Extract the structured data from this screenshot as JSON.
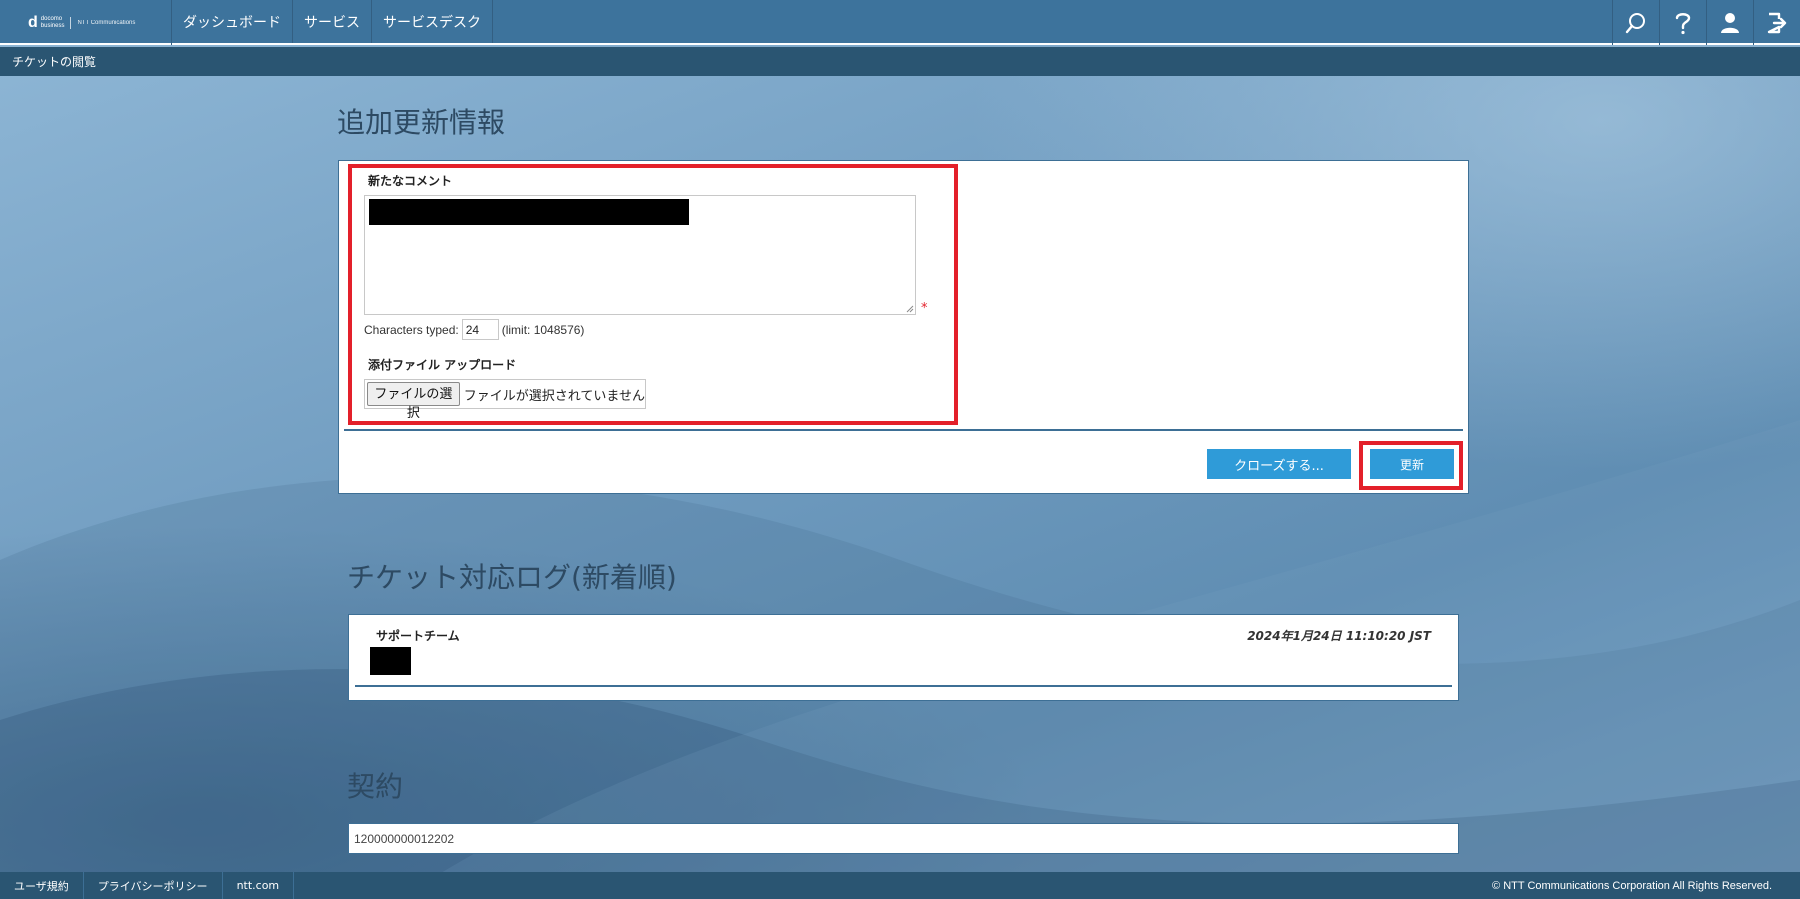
{
  "header": {
    "logo": {
      "mark": "d",
      "line1": "docomo",
      "line2": "business",
      "partner": "NTT Communications"
    },
    "nav": [
      "ダッシュボード",
      "サービス",
      "サービスデスク"
    ],
    "icons": [
      "search-icon",
      "help-icon",
      "user-icon",
      "logout-icon"
    ]
  },
  "breadcrumb": "チケットの閲覧",
  "update_section": {
    "title": "追加更新情報",
    "comment_label": "新たなコメント",
    "required_mark": "*",
    "counter": {
      "prefix": "Characters typed:",
      "value": "24",
      "limit": "(limit: 1048576)"
    },
    "attachment_label": "添付ファイル アップロード",
    "file_button": "ファイルの選択",
    "file_status": "ファイルが選択されていません",
    "close_button": "クローズする...",
    "update_button": "更新"
  },
  "log_section": {
    "title": "チケット対応ログ(新着順)",
    "entries": [
      {
        "author": "サポートチーム",
        "date": "2024年1月24日 11:10:20 JST"
      }
    ]
  },
  "contract_section": {
    "title": "契約",
    "value": "120000000012202"
  },
  "footer": {
    "links": [
      "ユーザ規約",
      "プライバシーポリシー",
      "ntt.com"
    ],
    "copyright": "© NTT Communications Corporation All Rights Reserved."
  },
  "colors": {
    "topbar": "#3d739c",
    "subbar": "#2a5572",
    "button": "#2f9bd8",
    "highlight": "#e3202a",
    "panel_border": "#3d6f95"
  }
}
